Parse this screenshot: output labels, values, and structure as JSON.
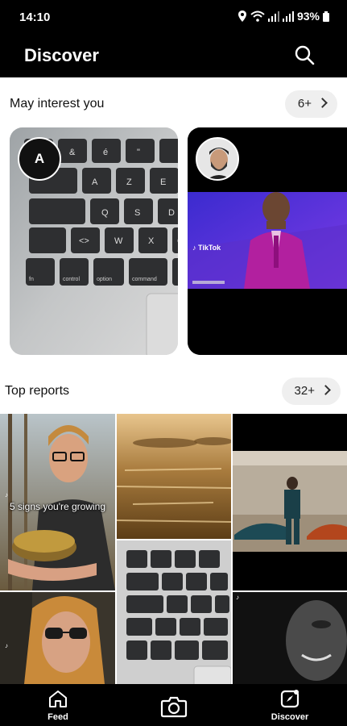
{
  "status": {
    "time": "14:10",
    "battery": "93%"
  },
  "header": {
    "title": "Discover",
    "search_icon": "search-icon"
  },
  "interest": {
    "title": "May interest you",
    "count": "6+",
    "card1_avatar_letter": "A"
  },
  "reports": {
    "title": "Top reports",
    "count": "32+"
  },
  "tiles": {
    "tile1_caption": "5 signs you're growing"
  },
  "keyboard": {
    "row1": [
      "&",
      "é",
      "\"",
      "'",
      "("
    ],
    "row2": [
      "A",
      "Z",
      "E"
    ],
    "row3": [
      "Q",
      "S",
      "D"
    ],
    "row4": [
      "<>",
      "W",
      "X",
      "C"
    ],
    "row5": [
      "fn",
      "control",
      "option",
      "command"
    ]
  },
  "nav": {
    "feed": "Feed",
    "discover": "Discover"
  },
  "colors": {
    "accent": "#ffffff",
    "purple_stage": "#5b2bd6",
    "suit": "#b2209f"
  }
}
